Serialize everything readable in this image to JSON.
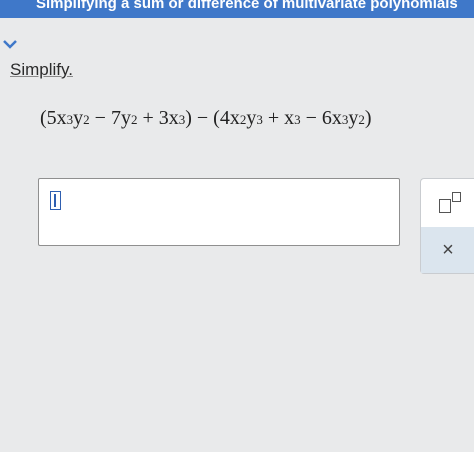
{
  "header": {
    "title": "Simplifying a sum or difference of multivariate polynomials"
  },
  "question": {
    "prompt": "Simplify.",
    "expression": [
      {
        "t": "(5x"
      },
      {
        "s": "3"
      },
      {
        "t": "y"
      },
      {
        "s": "2"
      },
      {
        "t": " − 7y"
      },
      {
        "s": "2"
      },
      {
        "t": " + 3x"
      },
      {
        "s": "3"
      },
      {
        "t": ") − (4x"
      },
      {
        "s": "2"
      },
      {
        "t": "y"
      },
      {
        "s": "3"
      },
      {
        "t": " + x"
      },
      {
        "s": "3"
      },
      {
        "t": " − 6x"
      },
      {
        "s": "3"
      },
      {
        "t": "y"
      },
      {
        "s": "2"
      },
      {
        "t": ")"
      }
    ]
  },
  "answer": {
    "value": ""
  },
  "tools": {
    "exponent_icon": "exponent-template-icon",
    "clear_label": "×"
  },
  "colors": {
    "header_bg": "#3f78c9",
    "cursor": "#2f5fb0",
    "clear_bg": "#dbe5ee"
  }
}
